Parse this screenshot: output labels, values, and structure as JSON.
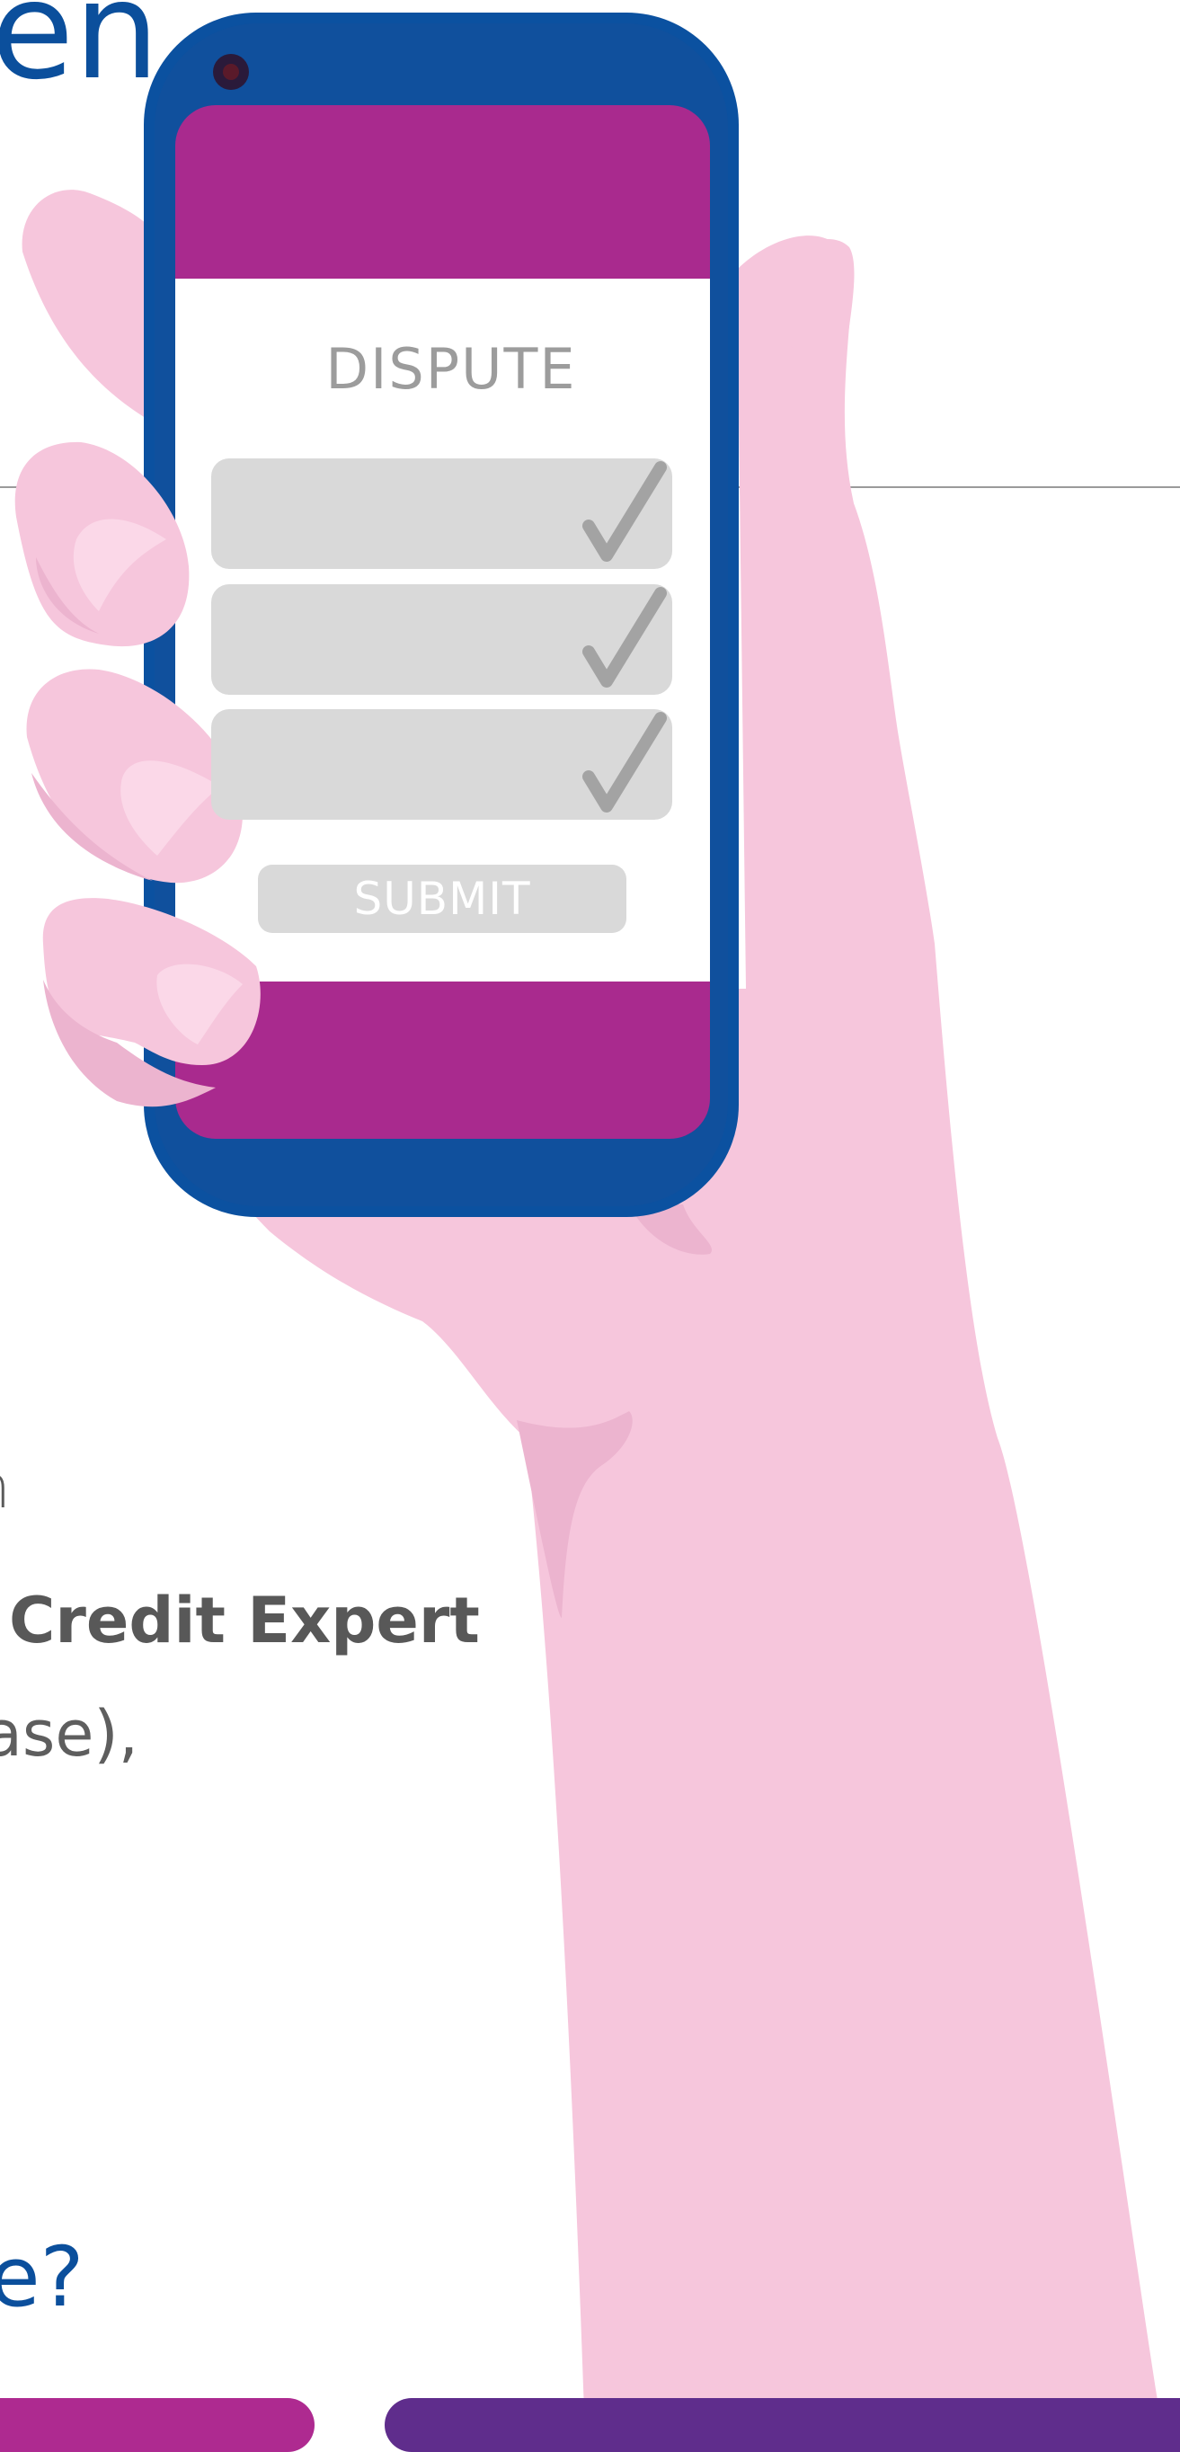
{
  "page": {
    "heading_fragment": "en",
    "paragraph_fragment_1": "n",
    "paragraph_bold_fragment": "Credit Expert",
    "paragraph_fragment_2": "ase),",
    "question_fragment": "e?"
  },
  "phone": {
    "screen_title": "DISPUTE",
    "fields": [
      {
        "checked": true,
        "icon": "checkmark-icon"
      },
      {
        "checked": true,
        "icon": "checkmark-icon"
      },
      {
        "checked": true,
        "icon": "checkmark-icon"
      }
    ],
    "submit_label": "SUBMIT"
  },
  "colors": {
    "brand_blue": "#0b4f9c",
    "phone_body": "#0b51a0",
    "screen_accent": "#a92a8e",
    "skin": "#f6c6dc",
    "field_bg": "#d9d9d9",
    "check": "#a3a3a3",
    "button_magenta": "#ae2a90",
    "button_purple": "#5f2d8c"
  }
}
